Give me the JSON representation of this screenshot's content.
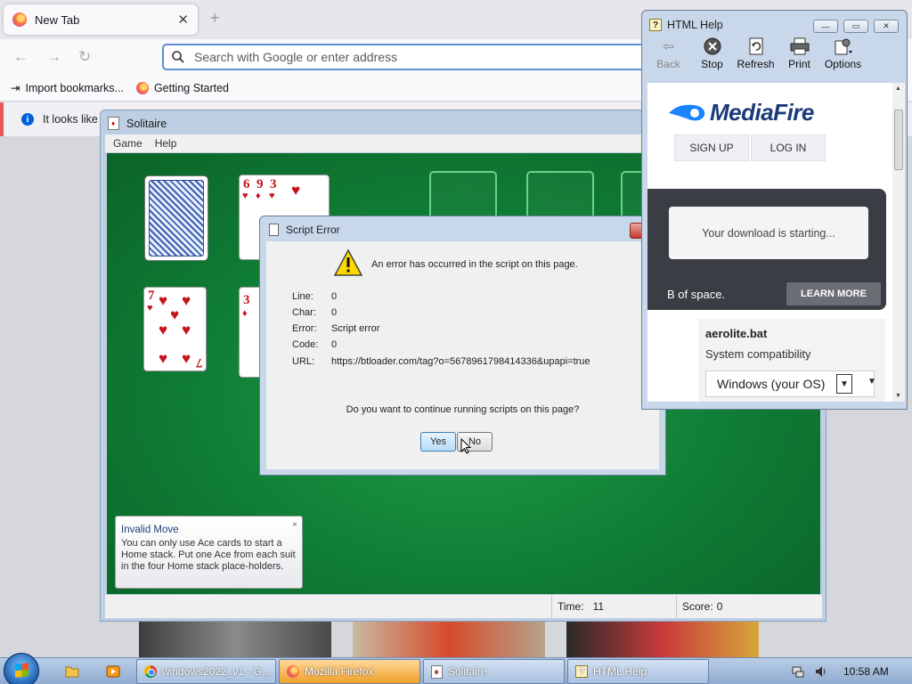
{
  "firefox": {
    "tab_title": "New Tab",
    "tab_close": "✕",
    "new_tab": "+",
    "search_placeholder": "Search with Google or enter address",
    "bookmarks": [
      "Import bookmarks...",
      "Getting Started"
    ],
    "notice": "It looks like y"
  },
  "solitaire": {
    "title": "Solitaire",
    "menu": [
      "Game",
      "Help"
    ],
    "status": {
      "time_label": "Time:",
      "time_value": "11",
      "score_label": "Score:",
      "score_value": "0"
    },
    "tableau_cards": [
      {
        "rank": "6",
        "suit": "♥"
      },
      {
        "rank": "9",
        "suit": "♦"
      },
      {
        "rank": "3",
        "suit": "♥"
      },
      {
        "rank": "7",
        "suit": "♥"
      },
      {
        "rank": "3",
        "suit": "♦"
      }
    ],
    "tooltip": {
      "title": "Invalid Move",
      "text": "You can only use Ace cards to start a Home stack. Put one Ace from each suit in the four Home stack place-holders.",
      "close": "×"
    }
  },
  "script_error": {
    "title": "Script Error",
    "close": "x",
    "message": "An error has occurred in the script on this page.",
    "fields": [
      {
        "key": "Line:",
        "value": "0"
      },
      {
        "key": "Char:",
        "value": "0"
      },
      {
        "key": "Error:",
        "value": "Script error"
      },
      {
        "key": "Code:",
        "value": "0"
      },
      {
        "key": "URL:",
        "value": "https://btloader.com/tag?o=5678961798414336&upapi=true"
      }
    ],
    "question": "Do you want to continue running scripts on this page?",
    "yes": "Yes",
    "no": "No"
  },
  "html_help": {
    "title": "HTML Help",
    "toolbar": [
      "Back",
      "Stop",
      "Refresh",
      "Print",
      "Options"
    ],
    "mediafire": {
      "logo_text": "MediaFire",
      "sign_up": "SIGN UP",
      "log_in": "LOG IN",
      "download_msg": "Your download is starting...",
      "space_text": "B of space.",
      "learn_more": "LEARN MORE",
      "file_name": "aerolite.bat",
      "compat_label": "System compatibility",
      "os_select": "Windows (your OS)"
    }
  },
  "taskbar": {
    "items": [
      "windows2022_v1 - G...",
      "Mozilla Firefox",
      "Solitaire",
      "HTML Help"
    ],
    "clock": "10:58 AM"
  },
  "colors": {
    "felt": "#0f7c35",
    "firefox_accent": "#0060df",
    "taskbar_active": "#f0a02a",
    "mediafire_blue": "#1b3a7a"
  }
}
